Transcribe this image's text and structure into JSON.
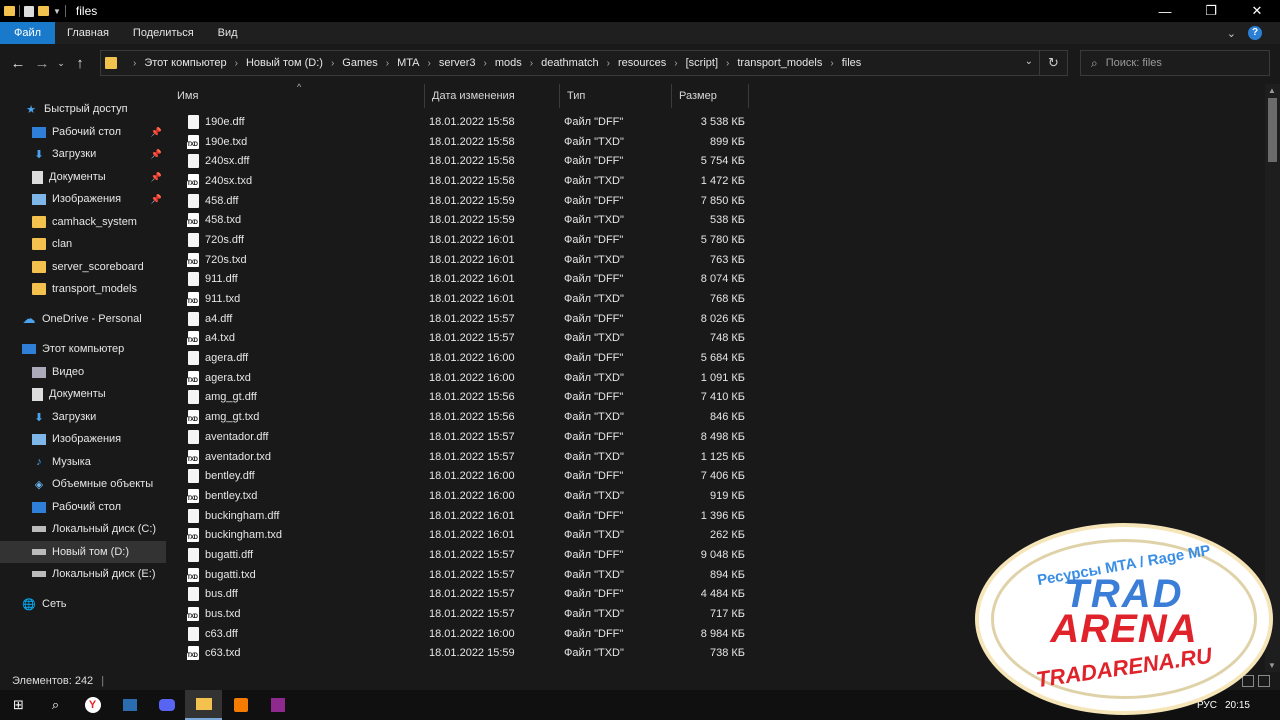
{
  "window": {
    "title": "files"
  },
  "ribbon": {
    "tabs": [
      "Файл",
      "Главная",
      "Поделиться",
      "Вид"
    ]
  },
  "address": {
    "crumbs": [
      "Этот компьютер",
      "Новый том (D:)",
      "Games",
      "MTA",
      "server3",
      "mods",
      "deathmatch",
      "resources",
      "[script]",
      "transport_models",
      "files"
    ]
  },
  "search": {
    "placeholder": "Поиск: files"
  },
  "sidebar": {
    "quick_access": "Быстрый доступ",
    "quick_items": [
      {
        "label": "Рабочий стол",
        "pinned": true
      },
      {
        "label": "Загрузки",
        "pinned": true
      },
      {
        "label": "Документы",
        "pinned": true
      },
      {
        "label": "Изображения",
        "pinned": true
      },
      {
        "label": "camhack_system"
      },
      {
        "label": "clan"
      },
      {
        "label": "server_scoreboard"
      },
      {
        "label": "transport_models"
      }
    ],
    "onedrive": "OneDrive - Personal",
    "this_pc": "Этот компьютер",
    "pc_items": [
      "Видео",
      "Документы",
      "Загрузки",
      "Изображения",
      "Музыка",
      "Объемные объекты",
      "Рабочий стол",
      "Локальный диск (C:)",
      "Новый том (D:)",
      "Локальный диск (E:)"
    ],
    "network": "Сеть"
  },
  "columns": {
    "name": "Имя",
    "date": "Дата изменения",
    "type": "Тип",
    "size": "Размер"
  },
  "files": [
    {
      "name": "190e.dff",
      "date": "18.01.2022 15:58",
      "type": "Файл \"DFF\"",
      "size": "3 538 КБ",
      "kind": "dff"
    },
    {
      "name": "190e.txd",
      "date": "18.01.2022 15:58",
      "type": "Файл \"TXD\"",
      "size": "899 КБ",
      "kind": "txd"
    },
    {
      "name": "240sx.dff",
      "date": "18.01.2022 15:58",
      "type": "Файл \"DFF\"",
      "size": "5 754 КБ",
      "kind": "dff"
    },
    {
      "name": "240sx.txd",
      "date": "18.01.2022 15:58",
      "type": "Файл \"TXD\"",
      "size": "1 472 КБ",
      "kind": "txd"
    },
    {
      "name": "458.dff",
      "date": "18.01.2022 15:59",
      "type": "Файл \"DFF\"",
      "size": "7 850 КБ",
      "kind": "dff"
    },
    {
      "name": "458.txd",
      "date": "18.01.2022 15:59",
      "type": "Файл \"TXD\"",
      "size": "538 КБ",
      "kind": "txd"
    },
    {
      "name": "720s.dff",
      "date": "18.01.2022 16:01",
      "type": "Файл \"DFF\"",
      "size": "5 780 КБ",
      "kind": "dff"
    },
    {
      "name": "720s.txd",
      "date": "18.01.2022 16:01",
      "type": "Файл \"TXD\"",
      "size": "763 КБ",
      "kind": "txd"
    },
    {
      "name": "911.dff",
      "date": "18.01.2022 16:01",
      "type": "Файл \"DFF\"",
      "size": "8 074 КБ",
      "kind": "dff"
    },
    {
      "name": "911.txd",
      "date": "18.01.2022 16:01",
      "type": "Файл \"TXD\"",
      "size": "768 КБ",
      "kind": "txd"
    },
    {
      "name": "a4.dff",
      "date": "18.01.2022 15:57",
      "type": "Файл \"DFF\"",
      "size": "8 026 КБ",
      "kind": "dff"
    },
    {
      "name": "a4.txd",
      "date": "18.01.2022 15:57",
      "type": "Файл \"TXD\"",
      "size": "748 КБ",
      "kind": "txd"
    },
    {
      "name": "agera.dff",
      "date": "18.01.2022 16:00",
      "type": "Файл \"DFF\"",
      "size": "5 684 КБ",
      "kind": "dff"
    },
    {
      "name": "agera.txd",
      "date": "18.01.2022 16:00",
      "type": "Файл \"TXD\"",
      "size": "1 091 КБ",
      "kind": "txd"
    },
    {
      "name": "amg_gt.dff",
      "date": "18.01.2022 15:56",
      "type": "Файл \"DFF\"",
      "size": "7 410 КБ",
      "kind": "dff"
    },
    {
      "name": "amg_gt.txd",
      "date": "18.01.2022 15:56",
      "type": "Файл \"TXD\"",
      "size": "846 КБ",
      "kind": "txd"
    },
    {
      "name": "aventador.dff",
      "date": "18.01.2022 15:57",
      "type": "Файл \"DFF\"",
      "size": "8 498 КБ",
      "kind": "dff"
    },
    {
      "name": "aventador.txd",
      "date": "18.01.2022 15:57",
      "type": "Файл \"TXD\"",
      "size": "1 125 КБ",
      "kind": "txd"
    },
    {
      "name": "bentley.dff",
      "date": "18.01.2022 16:00",
      "type": "Файл \"DFF\"",
      "size": "7 406 КБ",
      "kind": "dff"
    },
    {
      "name": "bentley.txd",
      "date": "18.01.2022 16:00",
      "type": "Файл \"TXD\"",
      "size": "919 КБ",
      "kind": "txd"
    },
    {
      "name": "buckingham.dff",
      "date": "18.01.2022 16:01",
      "type": "Файл \"DFF\"",
      "size": "1 396 КБ",
      "kind": "dff"
    },
    {
      "name": "buckingham.txd",
      "date": "18.01.2022 16:01",
      "type": "Файл \"TXD\"",
      "size": "262 КБ",
      "kind": "txd"
    },
    {
      "name": "bugatti.dff",
      "date": "18.01.2022 15:57",
      "type": "Файл \"DFF\"",
      "size": "9 048 КБ",
      "kind": "dff"
    },
    {
      "name": "bugatti.txd",
      "date": "18.01.2022 15:57",
      "type": "Файл \"TXD\"",
      "size": "894 КБ",
      "kind": "txd"
    },
    {
      "name": "bus.dff",
      "date": "18.01.2022 15:57",
      "type": "Файл \"DFF\"",
      "size": "4 484 КБ",
      "kind": "dff"
    },
    {
      "name": "bus.txd",
      "date": "18.01.2022 15:57",
      "type": "Файл \"TXD\"",
      "size": "717 КБ",
      "kind": "txd"
    },
    {
      "name": "c63.dff",
      "date": "18.01.2022 16:00",
      "type": "Файл \"DFF\"",
      "size": "8 984 КБ",
      "kind": "dff"
    },
    {
      "name": "c63.txd",
      "date": "18.01.2022 15:59",
      "type": "Файл \"TXD\"",
      "size": "738 КБ",
      "kind": "txd"
    }
  ],
  "status": {
    "count": "Элементов: 242"
  },
  "taskbar": {
    "lang": "РУС",
    "time": "20:15"
  },
  "watermark": {
    "top": "Ресурсы MTA / Rage MP",
    "line1": "TRAD",
    "line2": "ARENA",
    "bottom": "TRADARENA.RU"
  },
  "colors": {
    "accent": "#1979ca",
    "folder": "#f2c14e",
    "background": "#191919"
  }
}
